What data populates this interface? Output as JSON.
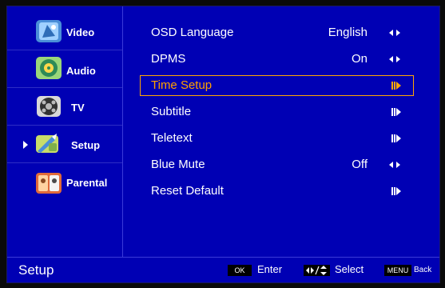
{
  "sidebar": {
    "items": [
      {
        "label": "Video",
        "icon": "video-icon"
      },
      {
        "label": "Audio",
        "icon": "audio-icon"
      },
      {
        "label": "TV",
        "icon": "tv-icon"
      },
      {
        "label": "Setup",
        "icon": "setup-icon",
        "active": true
      },
      {
        "label": "Parental",
        "icon": "parental-icon"
      }
    ]
  },
  "menu": {
    "items": [
      {
        "label": "OSD Language",
        "value": "English",
        "control": "left-right-arrows"
      },
      {
        "label": "DPMS",
        "value": "On",
        "control": "left-right-arrows"
      },
      {
        "label": "Time Setup",
        "value": "",
        "control": "enter-arrow",
        "selected": true
      },
      {
        "label": "Subtitle",
        "value": "",
        "control": "enter-arrow"
      },
      {
        "label": "Teletext",
        "value": "",
        "control": "enter-arrow"
      },
      {
        "label": "Blue Mute",
        "value": "Off",
        "control": "left-right-arrows"
      },
      {
        "label": "Reset Default",
        "value": "",
        "control": "enter-arrow"
      }
    ]
  },
  "footer": {
    "title": "Setup",
    "ok_key": "OK",
    "enter_label": "Enter",
    "select_label": "Select",
    "menu_key": "MENU",
    "back_label": "Back"
  },
  "colors": {
    "background": "#0000b4",
    "selected": "#ffa600",
    "text": "#ffffff"
  }
}
